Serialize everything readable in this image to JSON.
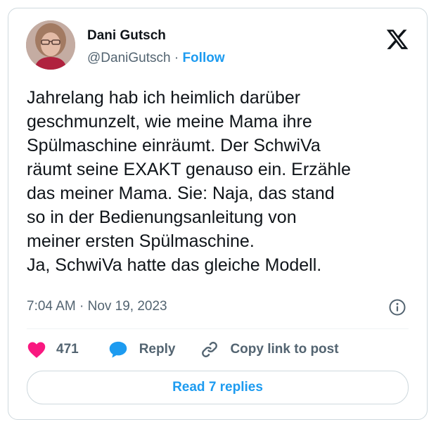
{
  "author": {
    "name": "Dani Gutsch",
    "handle": "@DaniGutsch",
    "separator": "·",
    "follow_label": "Follow"
  },
  "tweet": {
    "text": "Jahrelang hab ich heimlich darüber\ngeschmunzelt, wie meine Mama ihre\nSpülmaschine einräumt. Der SchwiVa\nräumt seine EXAKT genauso ein. Erzähle\ndas meiner Mama. Sie: Naja, das stand\nso in der Bedienungsanleitung von\nmeiner ersten Spülmaschine.\nJa, SchwiVa hatte das gleiche Modell.",
    "timestamp": "7:04 AM · Nov 19, 2023"
  },
  "actions": {
    "like_count": "471",
    "reply_label": "Reply",
    "copy_label": "Copy link to post"
  },
  "read_replies_label": "Read 7 replies",
  "icons": {
    "logo": "x-logo-icon",
    "info": "info-icon",
    "like": "heart-icon",
    "reply": "speech-bubble-icon",
    "copy": "link-icon"
  },
  "colors": {
    "accent": "#1d9bf0",
    "like": "#f91880",
    "muted_text": "#536471",
    "text": "#0f1419",
    "border": "#cfd9de"
  }
}
